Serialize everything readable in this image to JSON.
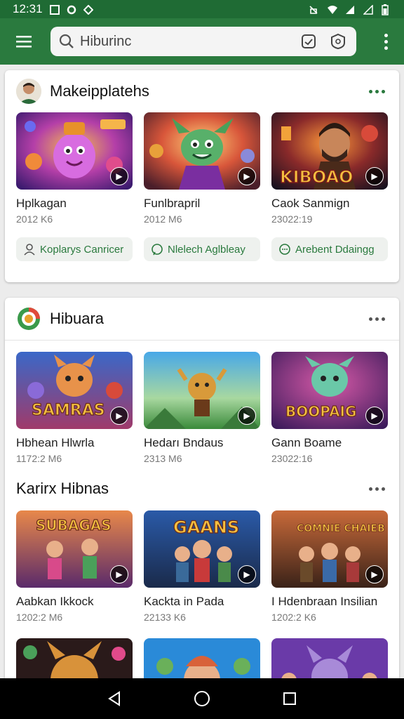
{
  "status_bar": {
    "time": "12:31"
  },
  "app_bar": {
    "search_text": "Hiburinc"
  },
  "card1": {
    "title": "Makeipplatehs",
    "tiles": [
      {
        "title": "Hplkagan",
        "meta": "2012 K6"
      },
      {
        "title": "Funlbrapril",
        "meta": "2012 M6"
      },
      {
        "title": "Caok Sanmign",
        "meta": "23022:19"
      }
    ],
    "chips": [
      {
        "label": "Koplarys Canricer"
      },
      {
        "label": "Nlelech Aglbleay"
      },
      {
        "label": "Arebent Ddaingg"
      }
    ]
  },
  "card2": {
    "title": "Hibuara",
    "tiles": [
      {
        "title": "Hbhean Hlwrla",
        "meta": "1172:2 M6"
      },
      {
        "title": "Hedarı Bndaus",
        "meta": "2313 M6"
      },
      {
        "title": "Gann Boame",
        "meta": "23022:16"
      }
    ],
    "section2_title": "Karirx Hibnas",
    "tiles2": [
      {
        "title": "Aabkan Ikkock",
        "meta": "1202:2 M6"
      },
      {
        "title": "Kackta in Pada",
        "meta": "22133 K6"
      },
      {
        "title": "I Hdenbraan Insilian",
        "meta": "1202:2 K6"
      }
    ]
  },
  "thumb_text": {
    "kiboao": "KIBOAO",
    "samras": "SAMRAS",
    "boopaig": "BOOPAIG",
    "subagas": "SUBAGAS",
    "gaans": "GAANS",
    "comnie": "COMNIE CHAIEB"
  },
  "colors": {
    "brand_green": "#2a7a3e",
    "status_green": "#1f6b34"
  }
}
